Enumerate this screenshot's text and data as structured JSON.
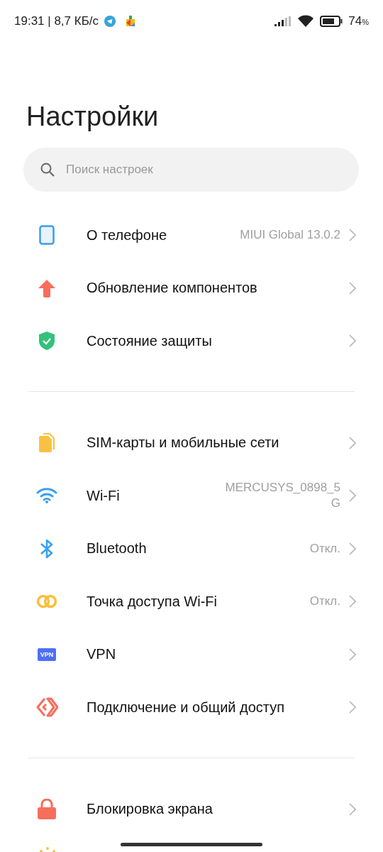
{
  "status_bar": {
    "time": "19:31 | 8,7 КБ/с",
    "battery": "74",
    "battery_unit": "%"
  },
  "title": "Настройки",
  "search": {
    "placeholder": "Поиск настроек"
  },
  "groups": [
    {
      "items": [
        {
          "kind": "phone",
          "label": "О телефоне",
          "value": "MIUI Global 13.0.2"
        },
        {
          "kind": "update",
          "label": "Обновление компонентов"
        },
        {
          "kind": "shield",
          "label": "Состояние защиты"
        }
      ]
    },
    {
      "items": [
        {
          "kind": "sim",
          "label": "SIM-карты и мобильные сети"
        },
        {
          "kind": "wifi",
          "label": "Wi-Fi",
          "value": "MERCUSYS_0898_5G"
        },
        {
          "kind": "bluetooth",
          "label": "Bluetooth",
          "value": "Откл."
        },
        {
          "kind": "hotspot",
          "label": "Точка доступа Wi-Fi",
          "value": "Откл."
        },
        {
          "kind": "vpn",
          "label": "VPN",
          "icon_text": "VPN"
        },
        {
          "kind": "share",
          "label": "Подключение и общий доступ"
        }
      ]
    },
    {
      "items": [
        {
          "kind": "lock",
          "label": "Блокировка экрана"
        }
      ]
    }
  ]
}
